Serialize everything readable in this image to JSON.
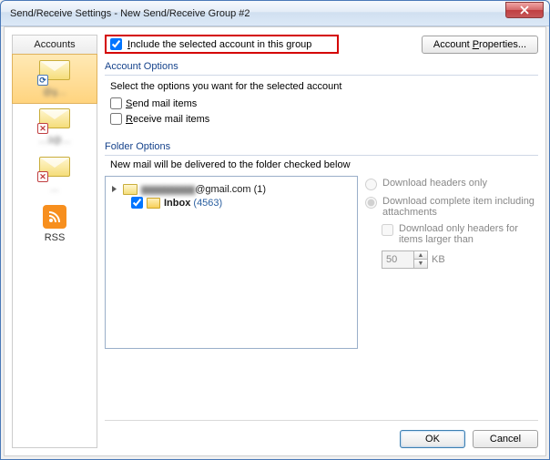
{
  "window": {
    "title": "Send/Receive Settings - New Send/Receive Group #2"
  },
  "sidebar": {
    "header": "Accounts",
    "items": [
      {
        "label": "@g…",
        "badge": "sync"
      },
      {
        "label": "…3@…",
        "badge": "err"
      },
      {
        "label": "…",
        "badge": "err"
      },
      {
        "label": "RSS",
        "badge": "rss"
      }
    ]
  },
  "include": {
    "checked": true,
    "label": "Include the selected account in this group"
  },
  "account_properties_btn": "Account Properties...",
  "account_options": {
    "title": "Account Options",
    "desc": "Select the options you want for the selected account",
    "send_label": "Send mail items",
    "send_checked": false,
    "receive_label": "Receive mail items",
    "receive_checked": false
  },
  "folder_options": {
    "title": "Folder Options",
    "desc": "New mail will be delivered to the folder checked below",
    "root_label": "@gmail.com",
    "root_count": "(1)",
    "inbox_label": "Inbox",
    "inbox_count": "(4563)",
    "inbox_checked": true
  },
  "download": {
    "headers_only": "Download headers only",
    "complete": "Download complete item including attachments",
    "only_headers_large": "Download only headers for items larger than",
    "size_value": "50",
    "size_unit": "KB",
    "selected": "complete"
  },
  "footer": {
    "ok": "OK",
    "cancel": "Cancel"
  }
}
